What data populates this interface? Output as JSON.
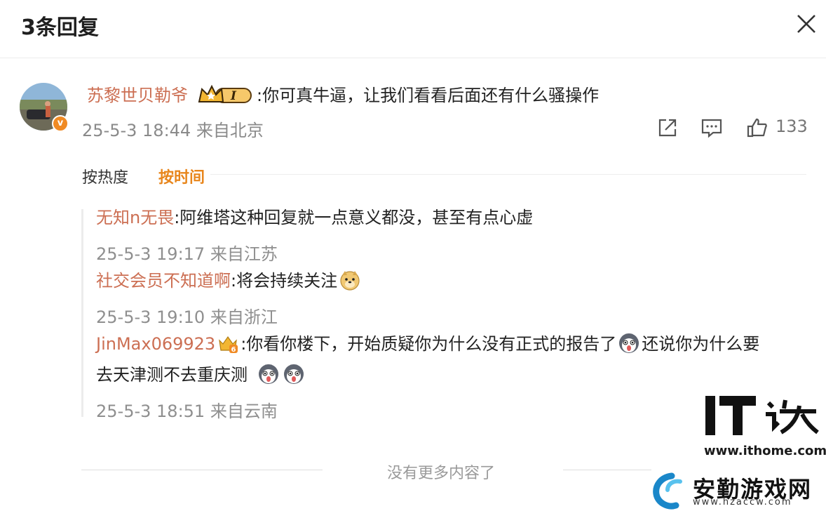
{
  "header": {
    "title": "3条回复"
  },
  "main_comment": {
    "username": "苏黎世贝勒爷",
    "badge_text": "I",
    "text": ":你可真牛逼，让我们看看后面还有什么骚操作",
    "meta": "25-5-3 18:44 来自北京",
    "like_count": "133"
  },
  "sort": {
    "hot": "按热度",
    "time": "按时间"
  },
  "replies": [
    {
      "username": "无知n无畏",
      "text": ":阿维塔这种回复就一点意义都没，甚至有点心虚",
      "meta": "25-5-3 19:17 来自江苏"
    },
    {
      "username": "社交会员不知道啊",
      "text": ":将会持续关注",
      "meta": "25-5-3 19:10 来自浙江"
    },
    {
      "username": "JinMax069923",
      "text1": ":你看你楼下，开始质疑你为什么没有正式的报告了",
      "text2": "还说你为什么要",
      "text3": "去天津测不去重庆测",
      "meta": "25-5-3 18:51 来自云南"
    }
  ],
  "footer": {
    "end_text": "没有更多内容了"
  },
  "watermarks": {
    "ithome_logo": "IT之家",
    "ithome_url": "www.ithome.com",
    "hzaccw_name": "安勤游戏网",
    "hzaccw_url": "www.hzaccw.com"
  }
}
